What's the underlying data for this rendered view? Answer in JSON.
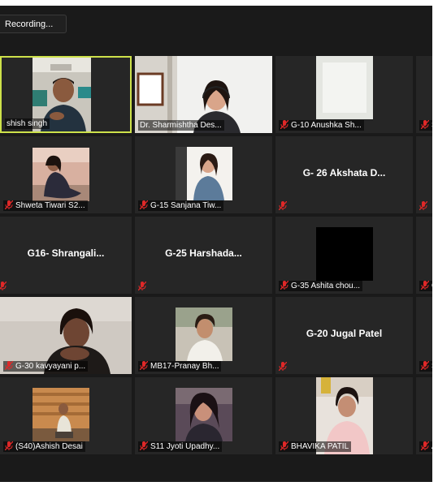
{
  "meeting": {
    "recording_label": "Recording...",
    "accent_color": "#cde14a",
    "muted_icon_color": "#e02828"
  },
  "participants": [
    {
      "name": "Ashish singh",
      "display": "shish singh"
    },
    {
      "name": "Dr. Sharmishtha Des..."
    },
    {
      "name": "G-10 Anushka Sh..."
    },
    {
      "name": "S"
    },
    {
      "name": "Shweta Tiwari S2..."
    },
    {
      "name": "G-15 Sanjana Tiw..."
    },
    {
      "name": "G- 26 Akshata D..."
    },
    {
      "name": "G16- Shrangali..."
    },
    {
      "name": "G-25 Harshada..."
    },
    {
      "name": "G-35 Ashita chou..."
    },
    {
      "name": "G"
    },
    {
      "name": "G-30 kavyayani p..."
    },
    {
      "name": "MB17-Pranay Bh..."
    },
    {
      "name": "G-20 Jugal Patel"
    },
    {
      "name": "(S40)Ashish Desai"
    },
    {
      "name": "S11 Jyoti Upadhy..."
    },
    {
      "name": "BHAVIKA PATIL"
    },
    {
      "name": "A"
    }
  ]
}
